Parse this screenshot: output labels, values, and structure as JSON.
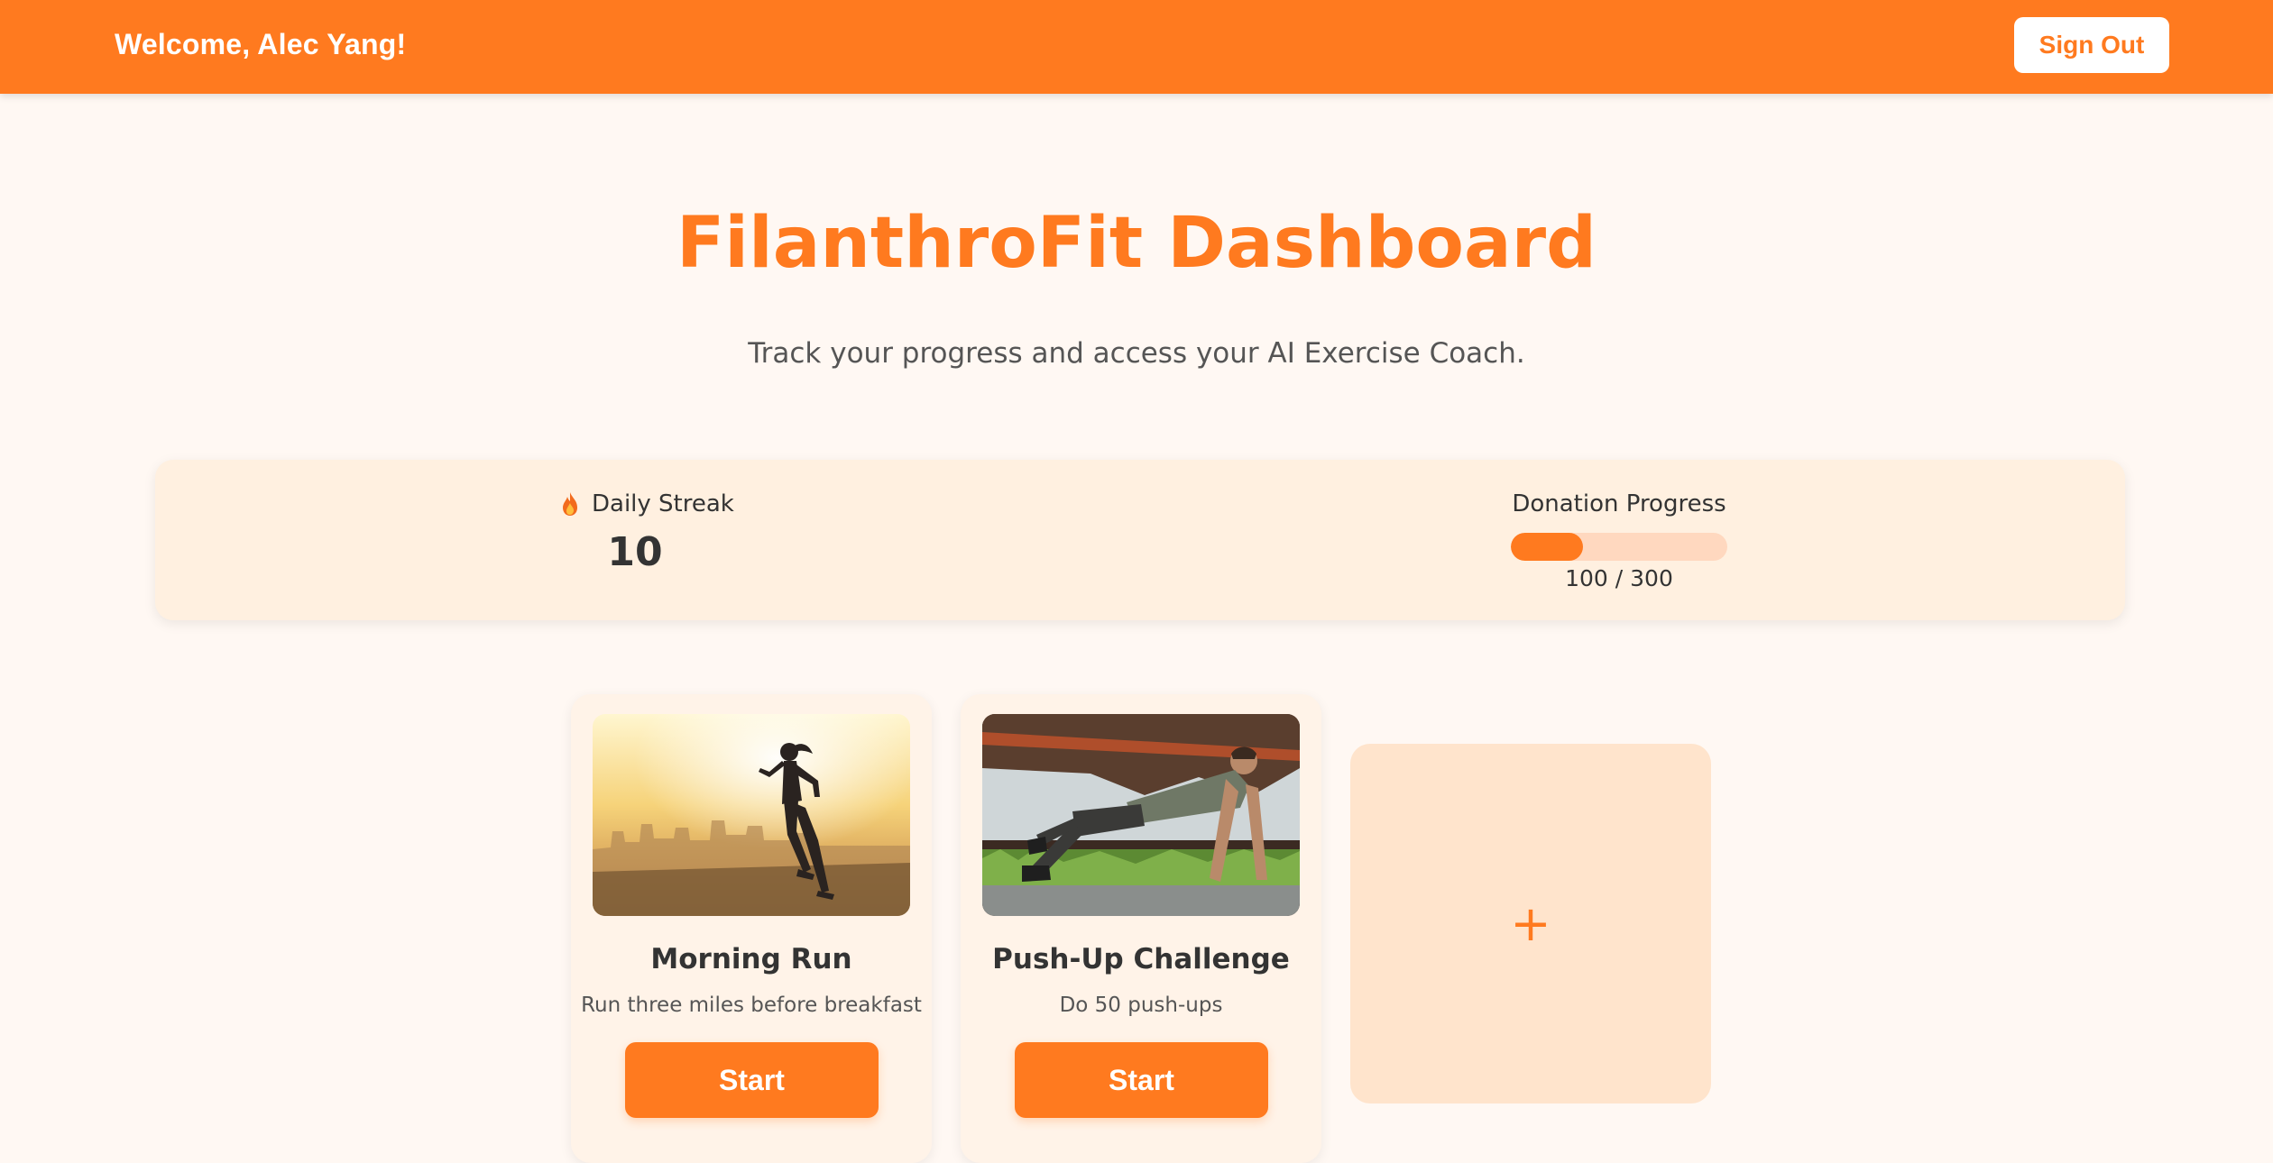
{
  "header": {
    "welcome": "Welcome, Alec Yang!",
    "sign_out_label": "Sign Out"
  },
  "hero": {
    "title": "FilanthroFit Dashboard",
    "subtitle": "Track your progress and access your AI Exercise Coach."
  },
  "stats": {
    "streak": {
      "icon": "flame-icon",
      "label": "Daily Streak",
      "value": "10"
    },
    "donation": {
      "label": "Donation Progress",
      "current": 100,
      "goal": 300,
      "display": "100 / 300"
    }
  },
  "cards": [
    {
      "title": "Morning Run",
      "description": "Run three miles before breakfast",
      "button_label": "Start",
      "image": "woman-running-photo"
    },
    {
      "title": "Push-Up Challenge",
      "description": "Do 50 push-ups",
      "button_label": "Start",
      "image": "man-pushup-photo"
    }
  ],
  "add_card": {
    "icon": "plus-icon",
    "symbol": "+"
  },
  "colors": {
    "accent": "#ff7a1f",
    "page_background": "#fff8f3",
    "panel_background": "#fff0e0",
    "add_card_background": "#ffe4cc",
    "progress_track": "#ffd8bf"
  }
}
